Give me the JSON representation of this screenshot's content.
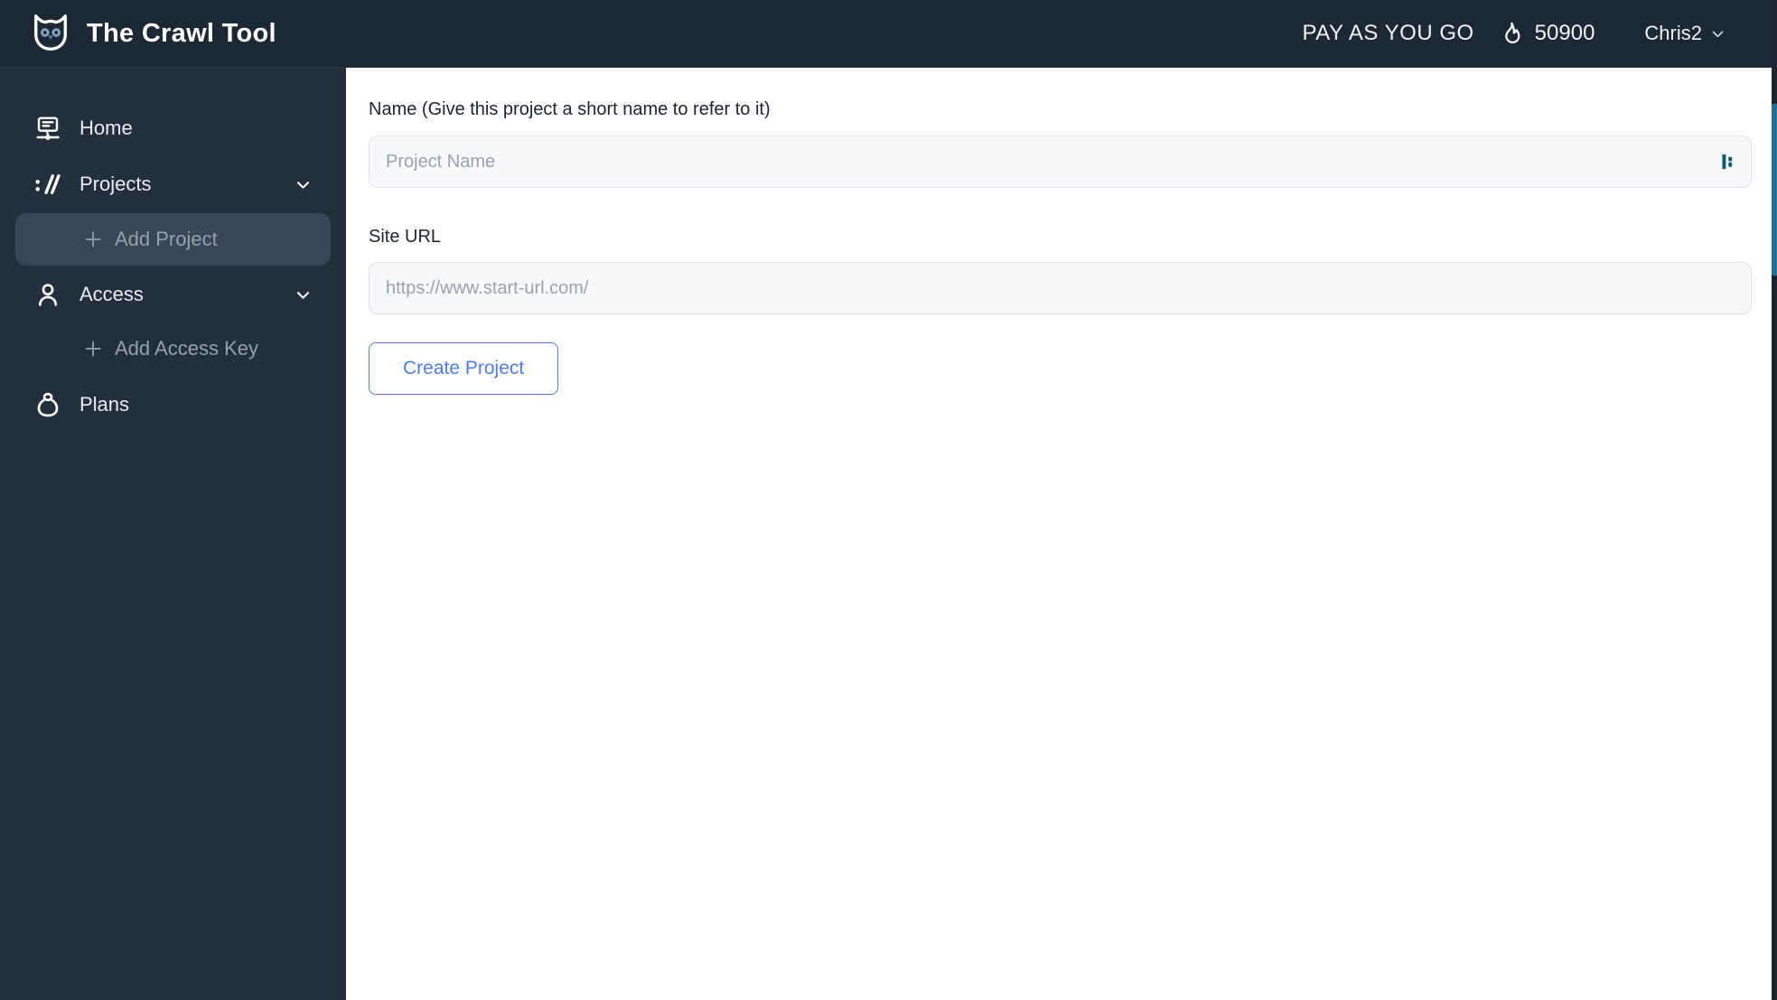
{
  "header": {
    "app_title": "The Crawl Tool",
    "plan_label": "PAY AS YOU GO",
    "credits": "50900",
    "username": "Chris2",
    "icons": [
      "owl-logo-icon",
      "flame-icon",
      "chevron-down-icon"
    ]
  },
  "sidebar": {
    "items": [
      {
        "label": "Home",
        "icon": "sitemap-screen-icon",
        "type": "top"
      },
      {
        "label": "Projects",
        "icon": "url-protocol-icon",
        "type": "top",
        "expanded": true
      },
      {
        "label": "Add Project",
        "icon": "plus-icon",
        "type": "sub",
        "active": true
      },
      {
        "label": "Access",
        "icon": "person-icon",
        "type": "top",
        "expanded": true
      },
      {
        "label": "Add Access Key",
        "icon": "plus-icon",
        "type": "sub",
        "active": false
      },
      {
        "label": "Plans",
        "icon": "money-bag-icon",
        "type": "top"
      }
    ]
  },
  "form": {
    "name_label": "Name (Give this project a short name to refer to it)",
    "name_placeholder": "Project Name",
    "name_value": "",
    "url_label": "Site URL",
    "url_placeholder": "https://www.start-url.com/",
    "url_value": "",
    "create_button_label": "Create Project",
    "name_input_addon_icon": "password-manager-autofill-icon"
  },
  "colors": {
    "header_bg": "#1d2835",
    "sidebar_bg": "#242f3e",
    "sidebar_active_item_bg": "#3a4555",
    "accent_blue": "#4d7cf3",
    "input_bg": "#f8f9fb",
    "scrollbar_thumb": "#1e7094",
    "autofill_icon_teal": "#0f5b6b"
  }
}
